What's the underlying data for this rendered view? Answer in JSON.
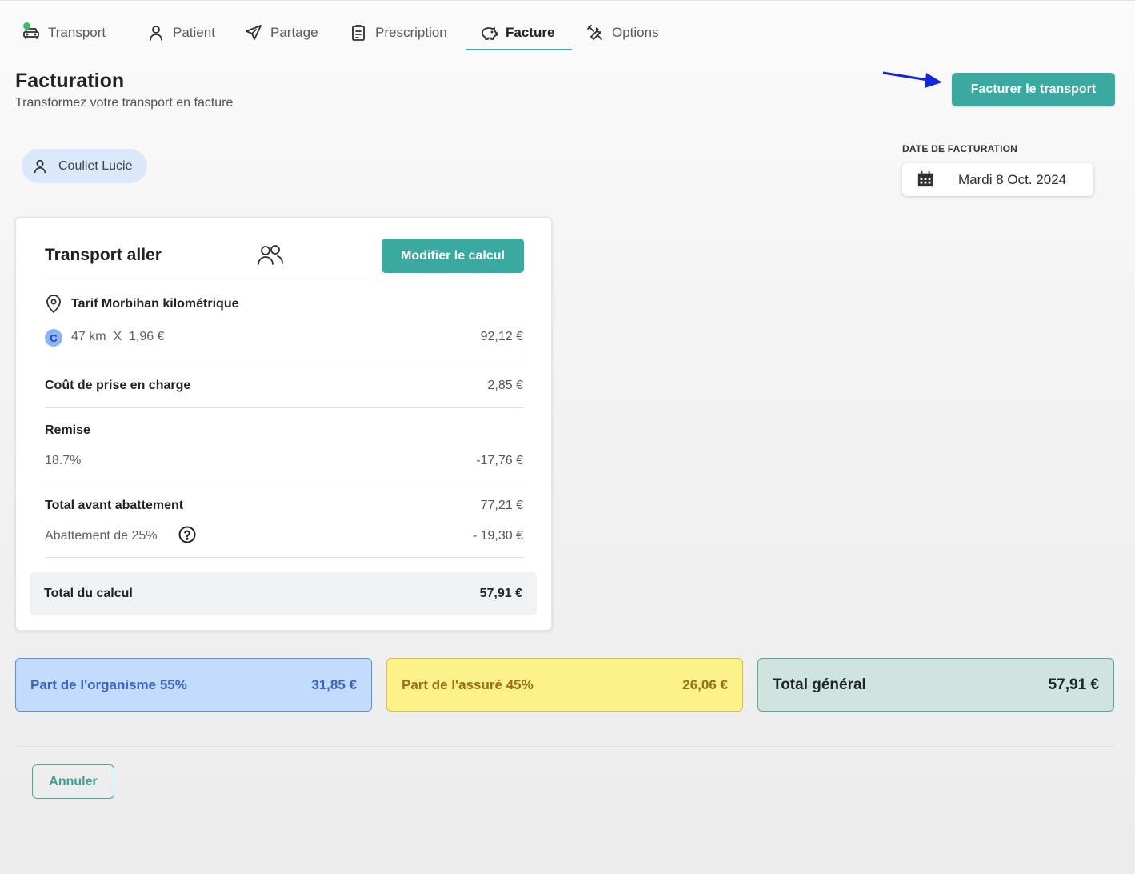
{
  "tabs": [
    {
      "label": "Transport",
      "icon": "car-icon"
    },
    {
      "label": "Patient",
      "icon": "user-icon"
    },
    {
      "label": "Partage",
      "icon": "send-icon"
    },
    {
      "label": "Prescription",
      "icon": "clipboard-icon"
    },
    {
      "label": "Facture",
      "icon": "piggy-bank-icon",
      "active": true
    },
    {
      "label": "Options",
      "icon": "tools-icon"
    }
  ],
  "header": {
    "title": "Facturation",
    "subtitle": "Transformez votre transport en facture",
    "invoice_button": "Facturer le transport"
  },
  "patient": {
    "name": "Coullet Lucie"
  },
  "billing_date": {
    "label": "DATE DE FACTURATION",
    "value": "Mardi 8 Oct. 2024"
  },
  "card": {
    "title": "Transport aller",
    "modify_button": "Modifier le calcul",
    "tariff": "Tarif Morbihan kilométrique",
    "badge": "C",
    "distance": "47 km  X  1,96 €",
    "distance_amount": "92,12 €",
    "pickup_label": "Coût de prise en charge",
    "pickup_amount": "2,85 €",
    "discount_label": "Remise",
    "discount_rate": "18.7%",
    "discount_amount": "-17,76 €",
    "subtotal_label": "Total avant abattement",
    "subtotal_amount": "77,21 €",
    "abatement_label": "Abattement de 25%",
    "abatement_amount": "- 19,30 €",
    "total_label": "Total du calcul",
    "total_amount": "57,91 €"
  },
  "summary": {
    "organism_label": "Part de l'organisme 55%",
    "organism_amount": "31,85 €",
    "insured_label": "Part de l'assuré 45%",
    "insured_amount": "26,06 €",
    "grand_total_label": "Total général",
    "grand_total_amount": "57,91 €"
  },
  "footer": {
    "cancel_button": "Annuler"
  },
  "colors": {
    "accent": "#3aa9a0",
    "organism": "#c3dbfc",
    "insured": "#fdf18a",
    "total": "#cfe3df"
  }
}
